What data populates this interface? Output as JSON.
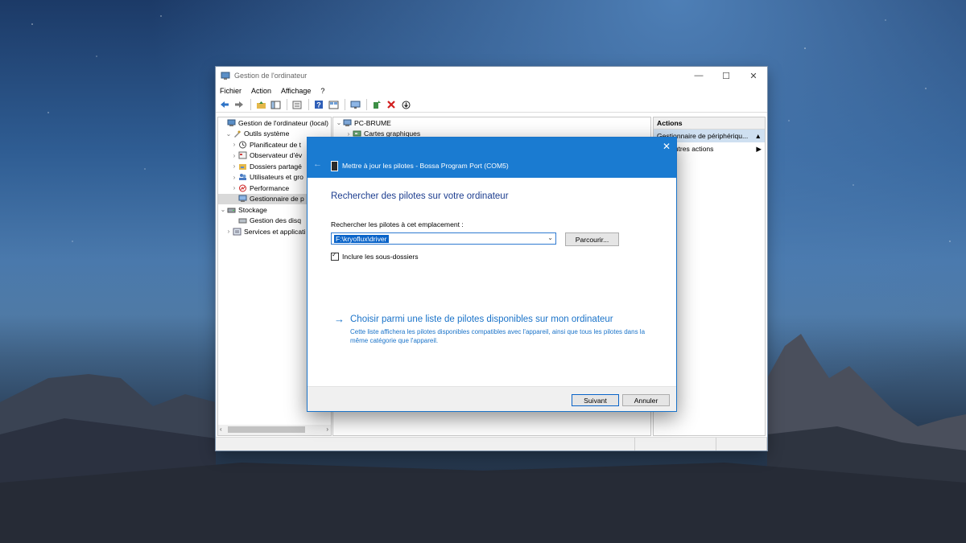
{
  "window": {
    "title": "Gestion de l'ordinateur",
    "controls": {
      "minimize": "—",
      "maximize": "☐",
      "close": "✕"
    }
  },
  "menu": [
    "Fichier",
    "Action",
    "Affichage",
    "?"
  ],
  "tree": [
    {
      "label": "Gestion de l'ordinateur (local)",
      "level": 0,
      "expander": "",
      "icon": "computer-management-icon"
    },
    {
      "label": "Outils système",
      "level": 1,
      "expander": "⌄",
      "icon": "tools-icon"
    },
    {
      "label": "Planificateur de t",
      "level": 2,
      "expander": "›",
      "icon": "clock-icon"
    },
    {
      "label": "Observateur d'év",
      "level": 2,
      "expander": "›",
      "icon": "event-viewer-icon"
    },
    {
      "label": "Dossiers partagé",
      "level": 2,
      "expander": "›",
      "icon": "shared-folder-icon"
    },
    {
      "label": "Utilisateurs et gro",
      "level": 2,
      "expander": "›",
      "icon": "users-icon"
    },
    {
      "label": "Performance",
      "level": 2,
      "expander": "›",
      "icon": "performance-icon"
    },
    {
      "label": "Gestionnaire de p",
      "level": 2,
      "expander": "",
      "icon": "device-manager-icon",
      "selected": true
    },
    {
      "label": "Stockage",
      "level": 0,
      "expander": "⌄",
      "icon": "storage-icon"
    },
    {
      "label": "Gestion des disq",
      "level": 2,
      "expander": "",
      "icon": "disk-icon"
    },
    {
      "label": "Services et applicati",
      "level": 1,
      "expander": "›",
      "icon": "services-icon"
    }
  ],
  "device_tree": [
    {
      "label": "PC-BRUME",
      "expander": "⌄",
      "icon": "computer-icon"
    },
    {
      "label": "Cartes graphiques",
      "expander": "›",
      "icon": "display-adapter-icon"
    }
  ],
  "actions": {
    "header": "Actions",
    "selected": "Gestionnaire de périphériqu...",
    "selected_arrow": "▲",
    "more": "Autres actions",
    "more_arrow": "▶"
  },
  "scroll": {
    "left": "‹",
    "right": "›"
  },
  "dialog": {
    "title": "Mettre à jour les pilotes - Bossa Program Port (COM5)",
    "back": "←",
    "close": "✕",
    "heading": "Rechercher des pilotes sur votre ordinateur",
    "location_label": "Rechercher les pilotes à cet emplacement :",
    "path_value": "F:\\kryoflux\\driver",
    "dropdown": "⌄",
    "browse": "Parcourir...",
    "include_subfolders": "Inclure les sous-dossiers",
    "include_subfolders_checked": true,
    "option_arrow": "→",
    "option_title": "Choisir parmi une liste de pilotes disponibles sur mon ordinateur",
    "option_desc": "Cette liste affichera les pilotes disponibles compatibles avec l'appareil, ainsi que tous les pilotes dans la même catégorie que l'appareil.",
    "next": "Suivant",
    "cancel": "Annuler"
  },
  "colors": {
    "accent": "#1a7bd1",
    "link": "#1a73c9",
    "heading": "#1c3d8f"
  }
}
